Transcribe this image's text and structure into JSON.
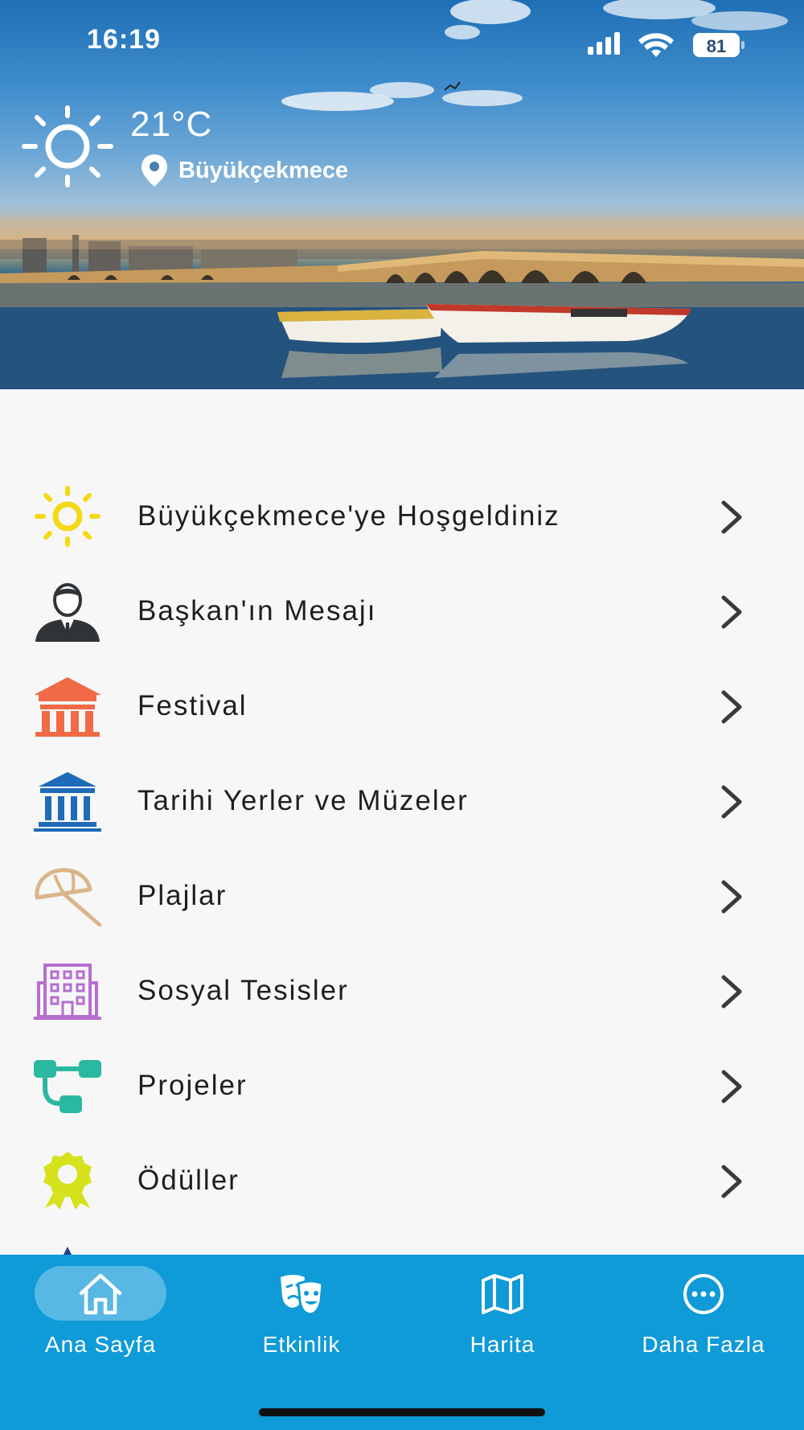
{
  "status_bar": {
    "time": "16:19",
    "battery": "81"
  },
  "weather": {
    "icon": "sun-icon",
    "temperature": "21°C",
    "location_icon": "location-pin-icon",
    "location": "Büyükçekmece"
  },
  "menu": {
    "items": [
      {
        "label": "Büyükçekmece'ye Hoşgeldiniz",
        "icon": "sun-icon",
        "color": "#f5d816"
      },
      {
        "label": "Başkan'ın Mesajı",
        "icon": "businessman-icon",
        "color": "#2f3438"
      },
      {
        "label": "Festival",
        "icon": "festival-tent-icon",
        "color": "#ef6a45"
      },
      {
        "label": "Tarihi Yerler ve Müzeler",
        "icon": "museum-icon",
        "color": "#1e6bb8"
      },
      {
        "label": "Plajlar",
        "icon": "beach-umbrella-icon",
        "color": "#d9b68a"
      },
      {
        "label": "Sosyal Tesisler",
        "icon": "building-icon",
        "color": "#b66ed0"
      },
      {
        "label": "Projeler",
        "icon": "projects-flow-icon",
        "color": "#2bb8a0"
      },
      {
        "label": "Ödüller",
        "icon": "award-icon",
        "color": "#d6e21c"
      }
    ]
  },
  "tabbar": {
    "tabs": [
      {
        "label": "Ana Sayfa",
        "icon": "home-icon",
        "active": true
      },
      {
        "label": "Etkinlik",
        "icon": "theater-masks-icon",
        "active": false
      },
      {
        "label": "Harita",
        "icon": "map-icon",
        "active": false
      },
      {
        "label": "Daha Fazla",
        "icon": "more-icon",
        "active": false
      }
    ]
  }
}
